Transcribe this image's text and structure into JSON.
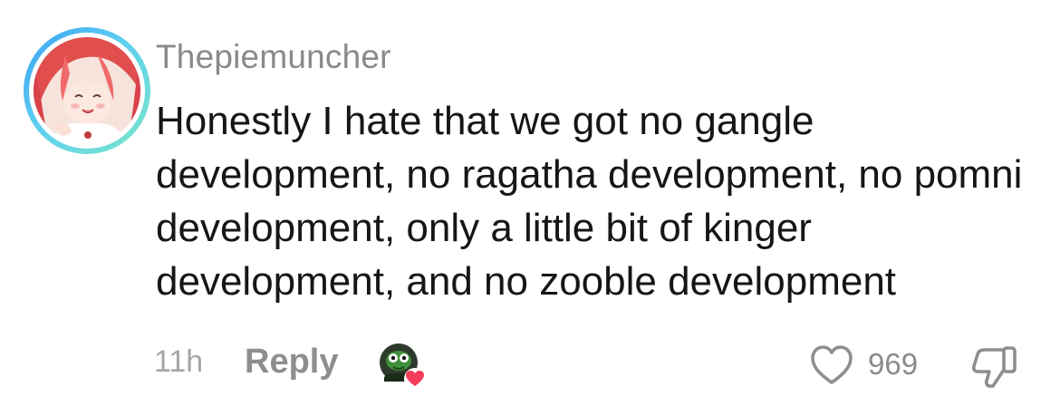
{
  "comment": {
    "username": "Thepiemuncher",
    "text": "Honestly I hate that we got no gangle development, no ragatha development, no pomni development, only a little bit of kinger development, and no zooble development",
    "time": "11h",
    "reply_label": "Reply",
    "like_count": "969"
  },
  "icons": {
    "avatar": "user-avatar",
    "reactor": "creator-liked-avatar",
    "like": "heart-outline-icon",
    "dislike": "thumbs-down-icon"
  },
  "colors": {
    "ring_start": "#3aa0f5",
    "ring_end": "#7ae6c8",
    "heart_badge": "#f43d5a",
    "text": "#161616",
    "muted": "#8a8a8a"
  }
}
